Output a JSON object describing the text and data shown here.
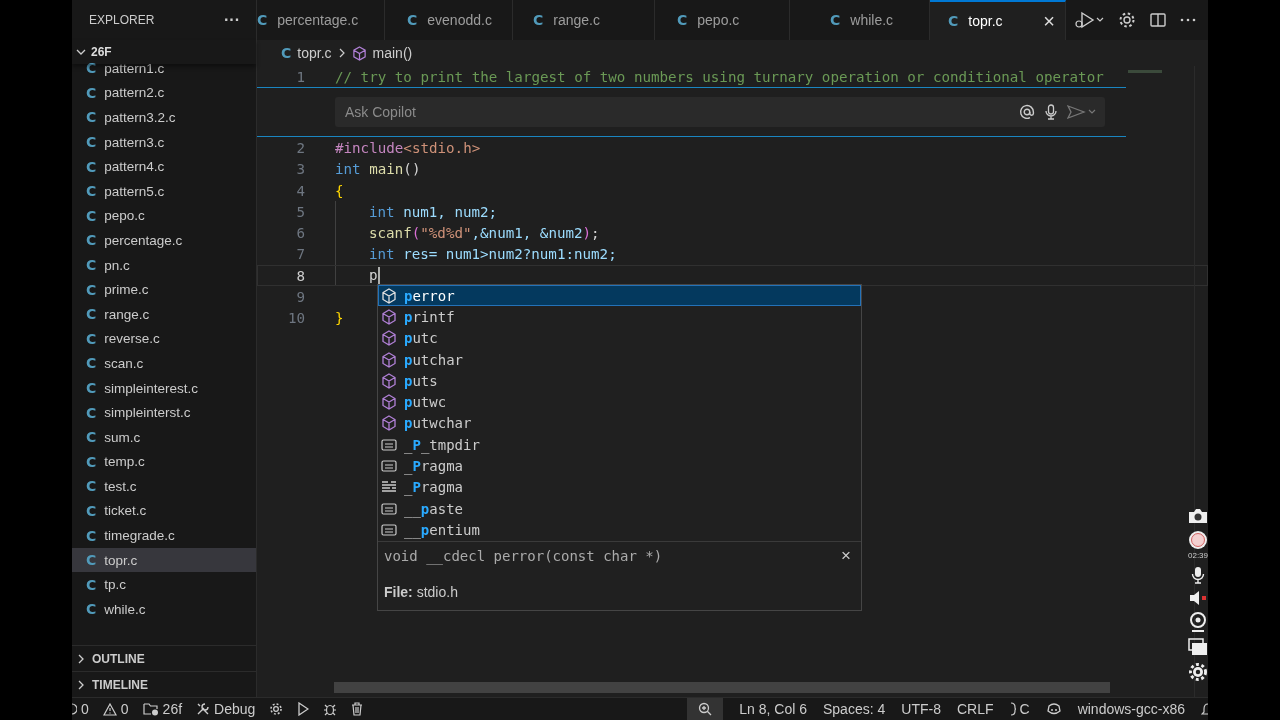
{
  "sidebar": {
    "title": "EXPLORER",
    "more": "···",
    "folder": {
      "name": "26F",
      "expanded": true
    },
    "files": [
      {
        "icon": "C",
        "name": "pattern1.c",
        "selected": false
      },
      {
        "icon": "C",
        "name": "pattern2.c",
        "selected": false
      },
      {
        "icon": "C",
        "name": "pattern3.2.c",
        "selected": false
      },
      {
        "icon": "C",
        "name": "pattern3.c",
        "selected": false
      },
      {
        "icon": "C",
        "name": "pattern4.c",
        "selected": false
      },
      {
        "icon": "C",
        "name": "pattern5.c",
        "selected": false
      },
      {
        "icon": "C",
        "name": "pepo.c",
        "selected": false
      },
      {
        "icon": "C",
        "name": "percentage.c",
        "selected": false
      },
      {
        "icon": "C",
        "name": "pn.c",
        "selected": false
      },
      {
        "icon": "C",
        "name": "prime.c",
        "selected": false
      },
      {
        "icon": "C",
        "name": "range.c",
        "selected": false
      },
      {
        "icon": "C",
        "name": "reverse.c",
        "selected": false
      },
      {
        "icon": "C",
        "name": "scan.c",
        "selected": false
      },
      {
        "icon": "C",
        "name": "simpleinterest.c",
        "selected": false
      },
      {
        "icon": "C",
        "name": "simpleinterst.c",
        "selected": false
      },
      {
        "icon": "C",
        "name": "sum.c",
        "selected": false
      },
      {
        "icon": "C",
        "name": "temp.c",
        "selected": false
      },
      {
        "icon": "C",
        "name": "test.c",
        "selected": false
      },
      {
        "icon": "C",
        "name": "ticket.c",
        "selected": false
      },
      {
        "icon": "C",
        "name": "timegrade.c",
        "selected": false
      },
      {
        "icon": "C",
        "name": "topr.c",
        "selected": true
      },
      {
        "icon": "C",
        "name": "tp.c",
        "selected": false
      },
      {
        "icon": "C",
        "name": "while.c",
        "selected": false
      }
    ],
    "sections": [
      {
        "name": "OUTLINE",
        "expanded": false
      },
      {
        "name": "TIMELINE",
        "expanded": false
      }
    ]
  },
  "tabs": [
    {
      "icon": "C",
      "label": "percentage.c",
      "selected": false
    },
    {
      "icon": "C",
      "label": "evenodd.c",
      "selected": false
    },
    {
      "icon": "C",
      "label": "range.c",
      "selected": false
    },
    {
      "icon": "C",
      "label": "pepo.c",
      "selected": false
    },
    {
      "icon": "C",
      "label": "while.c",
      "selected": false
    },
    {
      "icon": "C",
      "label": "topr.c",
      "selected": true,
      "close": "×"
    }
  ],
  "breadcrumbs": {
    "icon": "C",
    "file": "topr.c",
    "symbol": "main()"
  },
  "copilot": {
    "placeholder": "Ask Copilot"
  },
  "code": [
    {
      "number": "1",
      "tokens": [
        {
          "text": "// try to print the largest of two numbers using turnary operation or conditional operator",
          "kind": "comment"
        }
      ]
    },
    {
      "number": "2",
      "tokens": [
        {
          "text": "#include",
          "kind": "preproc"
        },
        {
          "text": "<stdio.h>",
          "kind": "string"
        }
      ]
    },
    {
      "number": "3",
      "tokens": [
        {
          "text": "int",
          "kind": "keyword"
        },
        {
          "text": " main",
          "kind": "func"
        },
        {
          "text": "()",
          "kind": "plain"
        }
      ]
    },
    {
      "number": "4",
      "tokens": [
        {
          "text": "{",
          "kind": "bracket"
        }
      ]
    },
    {
      "number": "5",
      "indent": true,
      "tokens": [
        {
          "text": "int",
          "kind": "keyword"
        },
        {
          "text": " num1, num2;",
          "kind": "var"
        }
      ]
    },
    {
      "number": "6",
      "indent": true,
      "tokens": [
        {
          "text": "scanf",
          "kind": "func"
        },
        {
          "text": "(",
          "kind": "bracket2"
        },
        {
          "text": "\"%d%d\"",
          "kind": "string"
        },
        {
          "text": ",&num1, &num2",
          "kind": "var"
        },
        {
          "text": ")",
          "kind": "bracket2"
        },
        {
          "text": ";",
          "kind": "plain"
        }
      ]
    },
    {
      "number": "7",
      "indent": true,
      "tokens": [
        {
          "text": "int",
          "kind": "keyword"
        },
        {
          "text": " res= num1>num2?num1:num2;",
          "kind": "var"
        }
      ]
    },
    {
      "number": "8",
      "current": true,
      "indent": true,
      "tokens": [
        {
          "text": "p",
          "kind": "plain"
        }
      ]
    },
    {
      "number": "9"
    },
    {
      "number": "10",
      "tokens": [
        {
          "text": "}",
          "kind": "bracket"
        }
      ]
    }
  ],
  "suggestions": {
    "items": [
      {
        "kind": "function",
        "match": "p",
        "after": "error",
        "selected": true
      },
      {
        "kind": "function",
        "match": "p",
        "after": "rintf",
        "selected": false
      },
      {
        "kind": "function",
        "match": "p",
        "after": "utc",
        "selected": false
      },
      {
        "kind": "function",
        "match": "p",
        "after": "utchar",
        "selected": false
      },
      {
        "kind": "function",
        "match": "p",
        "after": "uts",
        "selected": false
      },
      {
        "kind": "function",
        "match": "p",
        "after": "utwc",
        "selected": false
      },
      {
        "kind": "function",
        "match": "p",
        "after": "utwchar",
        "selected": false
      },
      {
        "kind": "macro",
        "before": "_",
        "match": "P",
        "after": "_tmpdir",
        "selected": false
      },
      {
        "kind": "macro",
        "before": "_",
        "match": "P",
        "after": "ragma",
        "selected": false
      },
      {
        "kind": "keyword",
        "before": "_",
        "match": "P",
        "after": "ragma",
        "selected": false
      },
      {
        "kind": "macro",
        "before": "__",
        "match": "p",
        "after": "aste",
        "selected": false
      },
      {
        "kind": "macro",
        "before": "__",
        "match": "p",
        "after": "entium",
        "selected": false
      }
    ],
    "signature": "void __cdecl perror(const char *)",
    "close": "×",
    "file_label": "File:",
    "file": "stdio.h"
  },
  "status_bar": {
    "errors": "0",
    "warnings": "0",
    "folder": "26f",
    "build": "Debug",
    "position": "Ln 8, Col 6",
    "indent": "Spaces: 4",
    "encoding": "UTF-8",
    "line_ending": "CRLF",
    "language": "C",
    "config": "windows-gcc-x86"
  },
  "recorder": {
    "timer": "02:39"
  }
}
